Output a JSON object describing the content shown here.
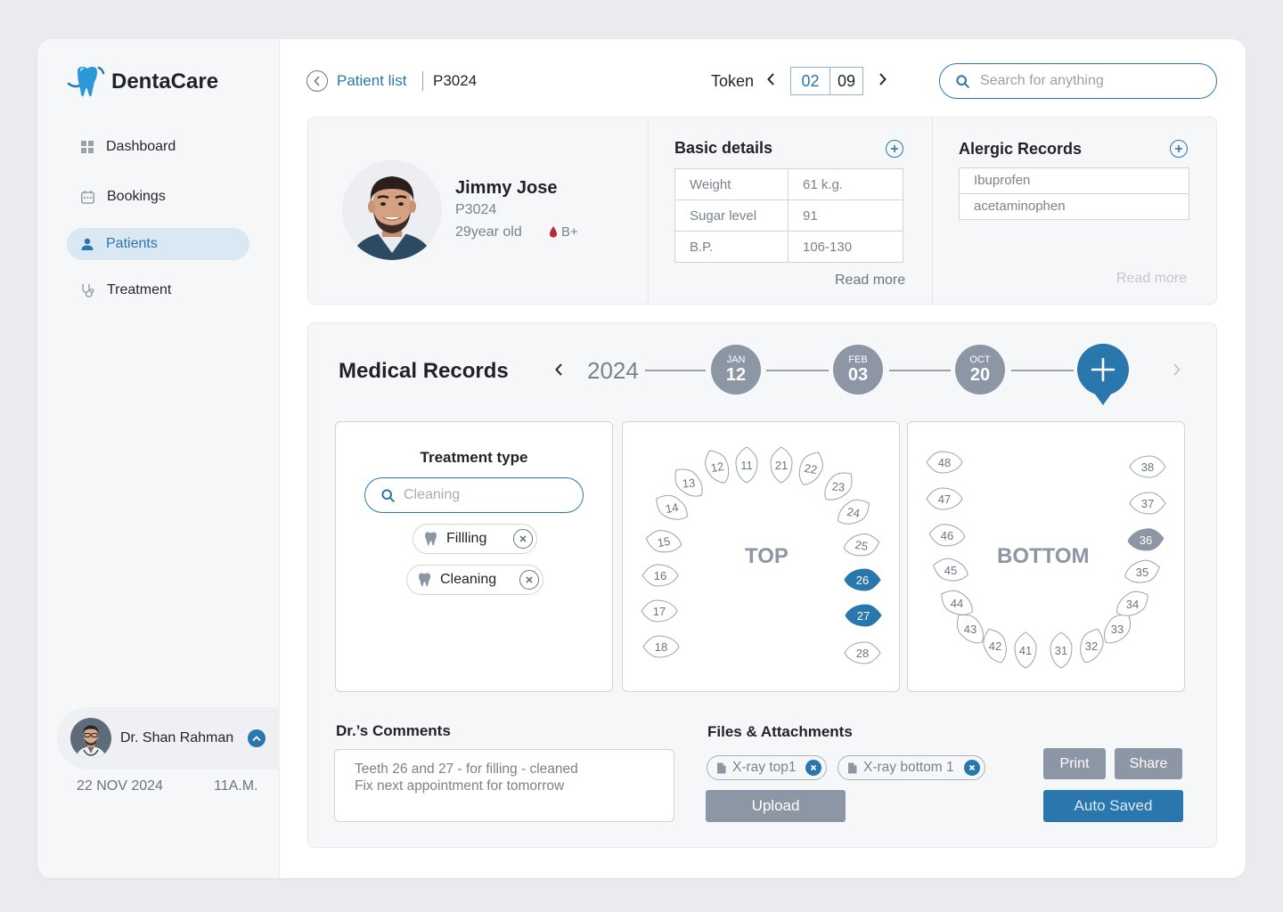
{
  "brand": {
    "name": "DentaCare"
  },
  "sidebar": {
    "items": [
      {
        "label": "Dashboard",
        "icon": "dashboard-grid-icon"
      },
      {
        "label": "Bookings",
        "icon": "calendar-icon"
      },
      {
        "label": "Patients",
        "icon": "person-icon",
        "active": true
      },
      {
        "label": "Treatment",
        "icon": "stethoscope-icon"
      }
    ],
    "user": {
      "name": "Dr. Shan Rahman",
      "date": "22 NOV 2024",
      "time": "11A.M."
    }
  },
  "header": {
    "breadcrumb_link": "Patient list",
    "patient_id": "P3024",
    "token_label": "Token",
    "token_current": "02",
    "token_total": "09",
    "search_placeholder": "Search for anything"
  },
  "patient": {
    "name": "Jimmy Jose",
    "id": "P3024",
    "age": "29year old",
    "blood_group": "B+"
  },
  "basic_details": {
    "title": "Basic details",
    "rows": [
      {
        "key": "Weight",
        "value": "61 k.g."
      },
      {
        "key": "Sugar level",
        "value": "91"
      },
      {
        "key": "B.P.",
        "value": "106-130"
      }
    ],
    "read_more": "Read more"
  },
  "allergic_records": {
    "title": "Alergic Records",
    "items": [
      "Ibuprofen",
      "acetaminophen"
    ],
    "read_more": "Read more"
  },
  "medical_records": {
    "title": "Medical Records",
    "year": "2024",
    "dates": [
      {
        "month": "JAN",
        "day": "12"
      },
      {
        "month": "FEB",
        "day": "03"
      },
      {
        "month": "OCT",
        "day": "20"
      }
    ]
  },
  "treatment": {
    "title": "Treatment type",
    "search_placeholder": "Cleaning",
    "chips": [
      "Fillling",
      "Cleaning"
    ]
  },
  "jaw_top": {
    "label": "TOP",
    "teeth": [
      "11",
      "12",
      "13",
      "14",
      "15",
      "16",
      "17",
      "18",
      "21",
      "22",
      "23",
      "24",
      "25",
      "26",
      "27",
      "28"
    ],
    "selected": [
      "26",
      "27"
    ],
    "selected_color": "#2a77ad"
  },
  "jaw_bottom": {
    "label": "BOTTOM",
    "teeth": [
      "31",
      "32",
      "33",
      "34",
      "35",
      "36",
      "37",
      "38",
      "41",
      "42",
      "43",
      "44",
      "45",
      "46",
      "47",
      "48"
    ],
    "selected": [
      "36"
    ],
    "selected_color": "#8d96a5"
  },
  "comments": {
    "title": "Dr.’s Comments",
    "line1": "Teeth 26 and 27 - for filling - cleaned",
    "line2": "Fix next appointment for tomorrow"
  },
  "files": {
    "title": "Files & Attachments",
    "items": [
      "X-ray top1",
      "X-ray bottom 1"
    ],
    "upload_label": "Upload"
  },
  "actions": {
    "print": "Print",
    "share": "Share",
    "auto_saved": "Auto Saved"
  },
  "colors": {
    "accent": "#2a77ad",
    "neutral": "#8d96a5",
    "blood": "#c0262d"
  }
}
